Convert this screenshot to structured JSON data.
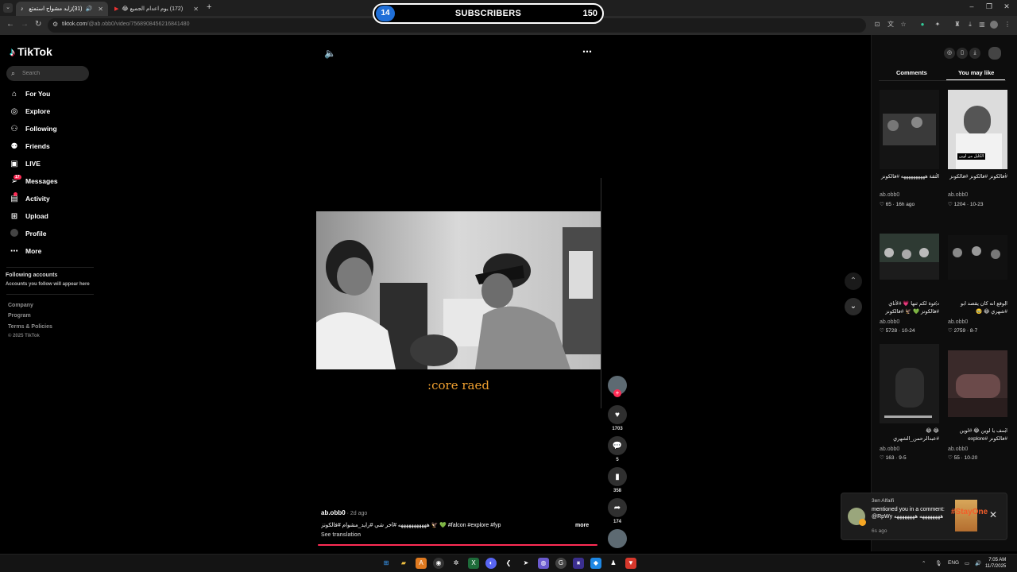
{
  "browser": {
    "tabs": [
      {
        "title": "(31)زايد مشواح استمتع بالحياة",
        "active": true
      },
      {
        "title": "(172) يوم اعدام الجميع 😂",
        "active": false
      }
    ],
    "url_host": "tiktok.com",
    "url_path": "/@ab.obb0/video/7568908456216841480"
  },
  "overlay": {
    "left_count": "14",
    "label": "SUBSCRIBERS",
    "right_count": "150"
  },
  "sidebar": {
    "logo": "TikTok",
    "search_placeholder": "Search",
    "items": [
      {
        "label": "For You",
        "icon": "home-icon"
      },
      {
        "label": "Explore",
        "icon": "compass-icon"
      },
      {
        "label": "Following",
        "icon": "person-icon"
      },
      {
        "label": "Friends",
        "icon": "friends-icon"
      },
      {
        "label": "LIVE",
        "icon": "live-icon"
      },
      {
        "label": "Messages",
        "icon": "paper-plane-icon",
        "badge": "17"
      },
      {
        "label": "Activity",
        "icon": "bell-icon"
      },
      {
        "label": "Upload",
        "icon": "plus-square-icon"
      },
      {
        "label": "Profile",
        "icon": "avatar-icon"
      },
      {
        "label": "More",
        "icon": "more-dots-icon"
      }
    ],
    "following_heading": "Following accounts",
    "following_sub": "Accounts you follow will appear here",
    "footer": [
      "Company",
      "Program",
      "Terms & Policies",
      "© 2025 TikTok"
    ]
  },
  "video": {
    "caption_overlay": ":core raed",
    "author": "ab.obb0",
    "age": " · 2d ago",
    "description": "هههههههههههه #أخر شي #رايد_مشوام #فالكونز 🦅 💚 #falcon #explore #fyp",
    "more_label": "more",
    "see_translation": "See translation",
    "likes": "1703",
    "comments": "5",
    "saves": "358",
    "shares": "174"
  },
  "right_panel": {
    "tabs": [
      "Comments",
      "You may like"
    ],
    "active_tab": "You may like",
    "cards": [
      {
        "title": "الثقة ههههههههههه #فالكونز 💚 🦅 #فالكونز",
        "author": "ab.obb0",
        "stats": "♡ 65 · 16h ago"
      },
      {
        "title": "#فالكونز #فالكونز #فالكونز 🦅 💚 هههههههههه",
        "author": "ab.obb0",
        "stats": "♡ 1204 · 10-23",
        "overlay_text": "الكليل من لوين"
      },
      {
        "title": "دعوة لكم ثنها 💗 #لأتاي #فالكونز 💚 🦅 #فالكونز",
        "author": "ab.obb0",
        "stats": "♡ 5728 · 10-24"
      },
      {
        "title": "الوقع انه كان يقصد ابو #شهري 😂 🥹",
        "author": "ab.obb0",
        "stats": "♡ 2759 · 8-7"
      },
      {
        "title": "😂 😂 #عبدالرحمن_الشهري",
        "author": "ab.obb0",
        "stats": "♡ 163 · 9-5"
      },
      {
        "title": "اسف يا لوين 😂 #لوين #فالكونز #explore",
        "author": "ab.obb0",
        "stats": "♡ 55 · 10-20"
      }
    ]
  },
  "toast": {
    "name": "3en Alfaifi",
    "message": "mentioned you in a comment: @RpWy ههههههههه ههههههههه",
    "time": "6s ago",
    "image_text": "#StayOne"
  },
  "taskbar": {
    "lang": "ENG",
    "time": "7:05 AM",
    "date": "11/7/2025"
  },
  "colors": {
    "accent": "#fe2c55",
    "overlay_blue": "#1f6fd8",
    "caption_orange": "#f0a030"
  }
}
